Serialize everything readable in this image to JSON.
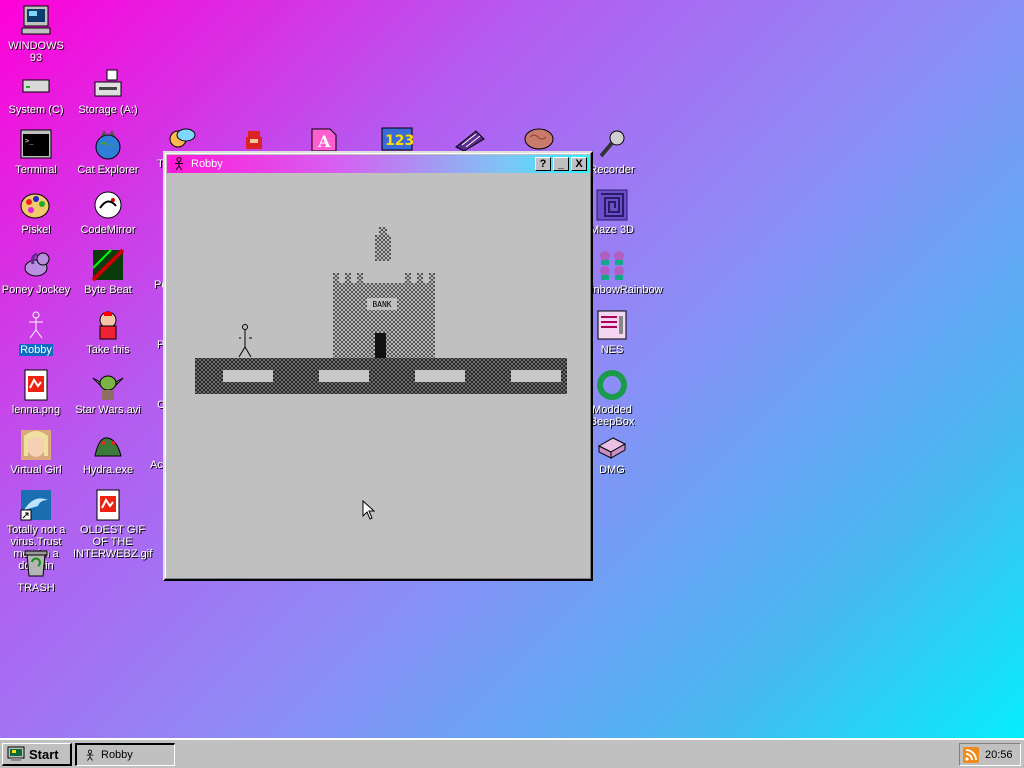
{
  "desktop": {
    "icons": [
      {
        "label": "WINDOWS 93",
        "icon": "computer-icon"
      },
      {
        "label": "System (C)",
        "icon": "drive-icon"
      },
      {
        "label": "Storage (A:)",
        "icon": "floppy-drive-icon"
      },
      {
        "label": "Terminal",
        "icon": "terminal-icon"
      },
      {
        "label": "Cat Explorer",
        "icon": "cat-globe-icon"
      },
      {
        "label": "Piskel",
        "icon": "palette-icon"
      },
      {
        "label": "CodeMirror",
        "icon": "codemirror-icon"
      },
      {
        "label": "Poney Jockey",
        "icon": "pony-icon"
      },
      {
        "label": "Byte Beat",
        "icon": "bytebeat-icon"
      },
      {
        "label": "Robby",
        "icon": "stick-figure-icon"
      },
      {
        "label": "Take this",
        "icon": "take-this-icon"
      },
      {
        "label": "lenna.png",
        "icon": "image-file-icon"
      },
      {
        "label": "Star Wars.avi",
        "icon": "yoda-icon"
      },
      {
        "label": "Virtual Girl",
        "icon": "girl-face-icon"
      },
      {
        "label": "Hydra.exe",
        "icon": "hydra-icon"
      },
      {
        "label": "Totally not a virus.Trust me...im a dolphin",
        "icon": "dolphin-icon"
      },
      {
        "label": "OLDEST GIF OF THE INTERWEBZ.gif",
        "icon": "gif-file-icon"
      },
      {
        "label": "TRASH",
        "icon": "trash-icon"
      },
      {
        "label": "Recorder",
        "icon": "microphone-icon"
      },
      {
        "label": "Maze 3D",
        "icon": "maze-icon"
      },
      {
        "label": "RainbowRainbow",
        "icon": "rainbow-people-icon"
      },
      {
        "label": "NES",
        "icon": "nes-icon"
      },
      {
        "label": "Modded BeepBox",
        "icon": "beepbox-icon"
      },
      {
        "label": "DMG",
        "icon": "dmg-icon"
      }
    ],
    "partial_labels": [
      "T",
      "Po",
      "P",
      "C",
      "Ac"
    ]
  },
  "window": {
    "title": "Robby",
    "help_label": "?",
    "minimize_label": "_",
    "close_label": "X",
    "game": {
      "bank_label": "BANK"
    }
  },
  "taskbar": {
    "start_label": "Start",
    "task_item": "Robby",
    "clock": "20:56"
  },
  "colors": {
    "selection": "#0a6fc2",
    "window_face": "#c0c0c0"
  }
}
